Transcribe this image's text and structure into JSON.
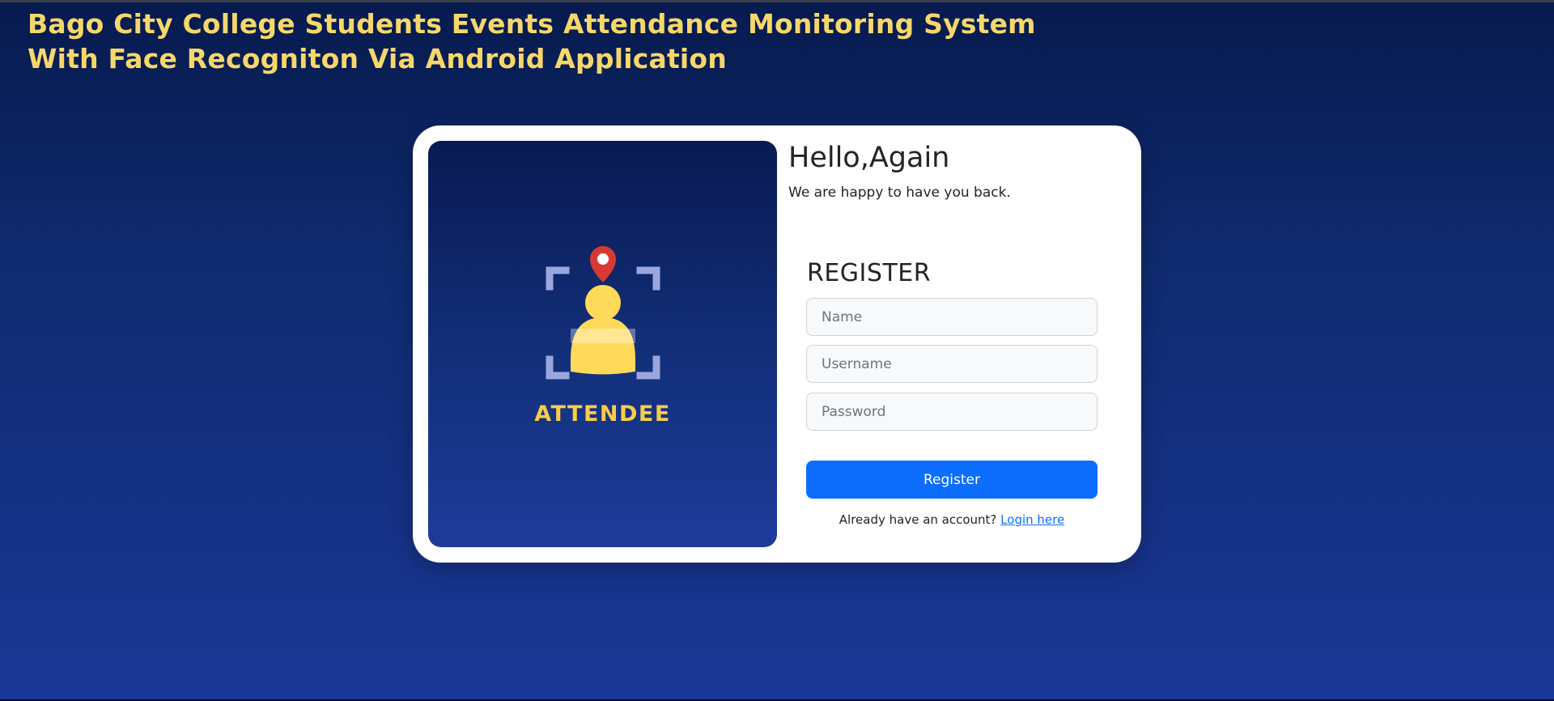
{
  "header": {
    "title_line1": "Bago City College Students Events Attendance Monitoring System",
    "title_line2": "With Face Recogniton Via Android Application"
  },
  "hero": {
    "logo_text": "ATTENDEE",
    "logo_icon": "face-recognition-person-pin-icon"
  },
  "greeting": {
    "title": "Hello,Again",
    "subtitle": "We are happy to have you back."
  },
  "form": {
    "title": "REGISTER",
    "name_placeholder": "Name",
    "username_placeholder": "Username",
    "password_placeholder": "Password",
    "submit_label": "Register",
    "login_prompt": "Already have an account?",
    "login_link": "Login here"
  },
  "colors": {
    "accent": "#0d6efd",
    "title_yellow": "#f7d76a",
    "background_dark": "#061a4d",
    "background_light": "#1a3796"
  }
}
